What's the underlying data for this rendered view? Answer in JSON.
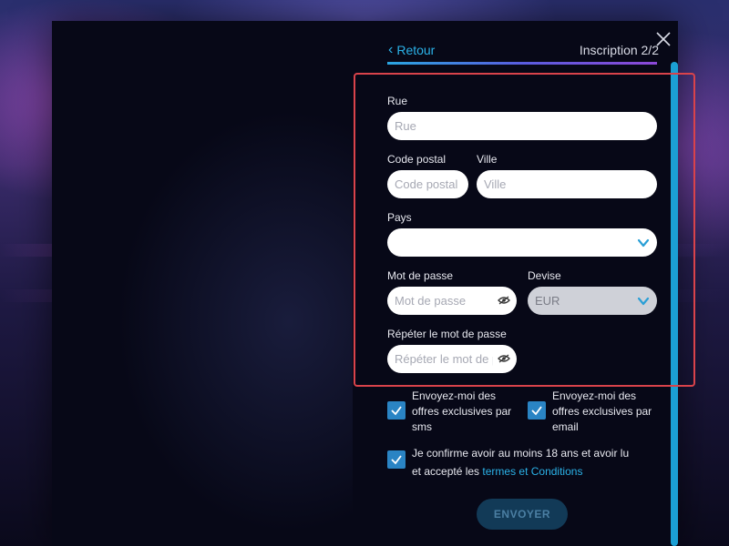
{
  "header": {
    "back_label": "Retour",
    "step_label": "Inscription 2/2"
  },
  "form": {
    "street": {
      "label": "Rue",
      "placeholder": "Rue"
    },
    "postal_code": {
      "label": "Code postal",
      "placeholder": "Code postal"
    },
    "city": {
      "label": "Ville",
      "placeholder": "Ville"
    },
    "country": {
      "label": "Pays",
      "value": ""
    },
    "password": {
      "label": "Mot de passe",
      "placeholder": "Mot de passe"
    },
    "currency": {
      "label": "Devise",
      "value": "EUR"
    },
    "password_repeat": {
      "label": "Répéter le mot de passe",
      "placeholder": "Répéter le mot de passe"
    }
  },
  "consents": {
    "sms": {
      "text": "Envoyez-moi des offres exclusives par sms",
      "checked": true
    },
    "email": {
      "text": "Envoyez-moi des offres exclusives par email",
      "checked": true
    },
    "terms": {
      "text_before": "Je confirme avoir au moins 18 ans et avoir lu et accepté les ",
      "link": "termes et Conditions",
      "checked": true
    }
  },
  "submit_label": "ENVOYER",
  "colors": {
    "accent": "#2bb2e8",
    "checkbox": "#2a84c4",
    "highlight": "#d9434b",
    "panel": "#070817"
  },
  "icons": [
    "chevron-left-icon",
    "close-icon",
    "chevron-down-icon",
    "eye-icon",
    "checkmark-icon"
  ]
}
